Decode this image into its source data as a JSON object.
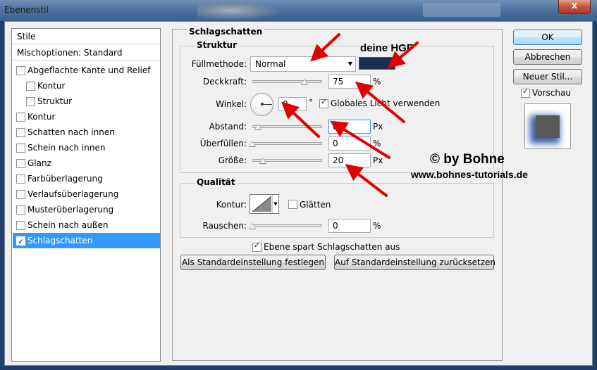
{
  "window": {
    "title": "Ebenenstil",
    "close_label": "x"
  },
  "stile": {
    "header": "Stile",
    "blend_options": "Mischoptionen: Standard",
    "items": [
      {
        "label": "Abgeflachte Kante und Relief",
        "checked": false
      },
      {
        "label": "Kontur",
        "checked": false
      },
      {
        "label": "Struktur",
        "checked": false
      },
      {
        "label": "Kontur",
        "checked": false
      },
      {
        "label": "Schatten nach innen",
        "checked": false
      },
      {
        "label": "Schein nach innen",
        "checked": false
      },
      {
        "label": "Glanz",
        "checked": false
      },
      {
        "label": "Farbüberlagerung",
        "checked": false
      },
      {
        "label": "Verlaufsüberlagerung",
        "checked": false
      },
      {
        "label": "Musterüberlagerung",
        "checked": false
      },
      {
        "label": "Schein nach außen",
        "checked": false
      },
      {
        "label": "Schlagschatten",
        "checked": true
      }
    ]
  },
  "schlagschatten": {
    "title": "Schlagschatten",
    "struktur": {
      "title": "Struktur",
      "blend_mode_label": "Füllmethode:",
      "blend_mode_value": "Normal",
      "shadow_color": "#1e2d4f",
      "opacity_label": "Deckkraft:",
      "opacity_value": "75",
      "opacity_unit": "%",
      "opacity_fraction": 0.75,
      "angle_label": "Winkel:",
      "angle_value": "0",
      "angle_unit": "°",
      "global_light_label": "Globales Licht verwenden",
      "global_light_checked": true,
      "distance_label": "Abstand:",
      "distance_value": "8",
      "distance_unit": "Px",
      "spread_label": "Überfüllen:",
      "spread_value": "0",
      "spread_unit": "%",
      "size_label": "Größe:",
      "size_value": "20",
      "size_unit": "Px"
    },
    "qualitaet": {
      "title": "Qualität",
      "contour_label": "Kontur:",
      "antialias_label": "Glätten",
      "antialias_checked": false,
      "noise_label": "Rauschen:",
      "noise_value": "0",
      "noise_unit": "%"
    },
    "layer_knockout_label": "Ebene spart Schlagschatten aus",
    "layer_knockout_checked": true,
    "make_default_label": "Als Standardeinstellung festlegen",
    "reset_default_label": "Auf Standardeinstellung zurücksetzen"
  },
  "actions": {
    "ok": "OK",
    "cancel": "Abbrechen",
    "new_style": "Neuer Stil...",
    "preview_label": "Vorschau",
    "preview_checked": true
  },
  "annotations": {
    "hgf": "deine HGF",
    "author": "© by Bohne",
    "website": "www.bohnes-tutorials.de",
    "arrow_color": "#e00000"
  }
}
